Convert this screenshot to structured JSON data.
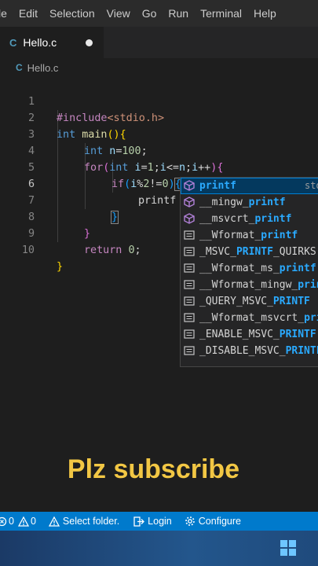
{
  "menubar": {
    "items": [
      "le",
      "Edit",
      "Selection",
      "View",
      "Go",
      "Run",
      "Terminal",
      "Help"
    ]
  },
  "tab": {
    "icon": "C",
    "label": "Hello.c",
    "modified_indicator": "dot"
  },
  "breadcrumb": {
    "icon": "C",
    "file": "Hello.c"
  },
  "editor": {
    "line_numbers": [
      "1",
      "2",
      "3",
      "4",
      "5",
      "6",
      "7",
      "8",
      "9",
      "10"
    ],
    "active_line": "6",
    "lines": [
      "#include<stdio.h>",
      "int main(){",
      "int n=100;",
      "for(int i=1;i<=n;i++){",
      "if(i%2!=0){",
      "printf",
      "}",
      "}",
      "return 0;",
      "}"
    ]
  },
  "suggest": {
    "items": [
      {
        "kind": "function",
        "text": "printf",
        "detail": "std",
        "selected": true
      },
      {
        "kind": "function",
        "text": "__mingw_printf"
      },
      {
        "kind": "function",
        "text": "__msvcrt_printf"
      },
      {
        "kind": "macro",
        "text": "__Wformat_printf"
      },
      {
        "kind": "macro",
        "text": "_MSVC_PRINTF_QUIRKS"
      },
      {
        "kind": "macro",
        "text": "__Wformat_ms_printf"
      },
      {
        "kind": "macro",
        "text": "__Wformat_mingw_printf"
      },
      {
        "kind": "macro",
        "text": "_QUERY_MSVC_PRINTF"
      },
      {
        "kind": "macro",
        "text": "__Wformat_msvcrt_printf"
      },
      {
        "kind": "macro",
        "text": "_ENABLE_MSVC_PRINTF"
      },
      {
        "kind": "macro",
        "text": "_DISABLE_MSVC_PRINTF"
      }
    ]
  },
  "caption": {
    "text": "Plz subscribe"
  },
  "statusbar": {
    "errors": "0",
    "warnings": "0",
    "select_folder": "Select folder.",
    "login": "Login",
    "configure": "Configure"
  },
  "colors": {
    "status_bar": "#007acc",
    "caption": "#f2c744",
    "suggest_highlight": "#2aaaff",
    "selected_item": "#04395e"
  }
}
